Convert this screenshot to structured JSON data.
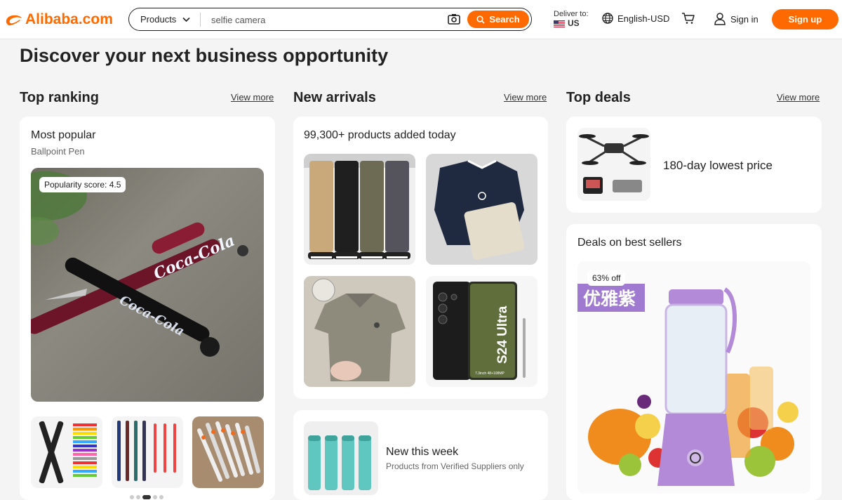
{
  "header": {
    "logo_text": "Alibaba.com",
    "search_category": "Products",
    "search_value": "selfie camera",
    "search_button": "Search",
    "deliver_label": "Deliver to:",
    "deliver_country": "US",
    "language_currency": "English-USD",
    "signin_label": "Sign in",
    "signup_label": "Sign up",
    "accent_color": "#ff6a00"
  },
  "page_title": "Discover your next business opportunity",
  "top_ranking": {
    "title": "Top ranking",
    "view_more": "View more",
    "card_title": "Most popular",
    "card_subtitle": "Ballpoint Pen",
    "popularity_badge": "Popularity score: 4.5",
    "pen_brand_text": "Coca-Cola",
    "carousel_total": 5,
    "carousel_active_index": 3
  },
  "new_arrivals": {
    "title": "New arrivals",
    "view_more": "View more",
    "card_title": "99,300+ products added today",
    "phone_model_text": "S24 Ultra",
    "phone_spec_text": "7.3inch 48+108MP",
    "week_title": "New this week",
    "week_subtitle": "Products from Verified Suppliers only"
  },
  "top_deals": {
    "title": "Top deals",
    "view_more": "View more",
    "lowest_price_text": "180-day lowest price",
    "best_sellers_title": "Deals on best sellers",
    "discount_badge": "63% off",
    "product_overlay_text": "优雅紫"
  }
}
